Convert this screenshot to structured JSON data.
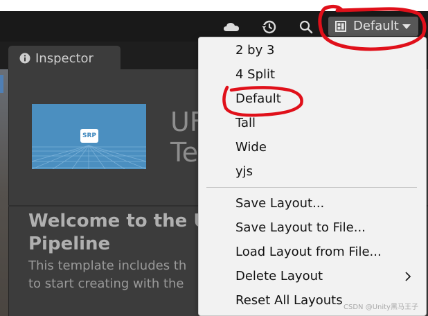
{
  "toolbar": {
    "cloud_icon": "cloud-icon",
    "history_icon": "history-icon",
    "search_icon": "search-icon",
    "layout_icon": "layout-icon",
    "layout_label": "Default"
  },
  "tab": {
    "icon": "info-icon",
    "label": "Inspector"
  },
  "inspector": {
    "preview_badge": "SRP",
    "title_line1": "UF",
    "title_line2": "Te",
    "heading_line1": "Welcome to the U",
    "heading_line2": "Pipeline",
    "body_line1": "This template includes th",
    "body_line2": "to start creating with the"
  },
  "menu": {
    "items": [
      {
        "label": "2 by 3"
      },
      {
        "label": "4 Split"
      },
      {
        "label": "Default"
      },
      {
        "label": "Tall"
      },
      {
        "label": "Wide"
      },
      {
        "label": "yjs"
      }
    ],
    "actions": [
      {
        "label": "Save Layout..."
      },
      {
        "label": "Save Layout to File..."
      },
      {
        "label": "Load Layout from File..."
      },
      {
        "label": "Delete Layout",
        "submenu": true
      },
      {
        "label": "Reset All Layouts"
      }
    ]
  },
  "colors": {
    "annotation": "#e0101a",
    "accent": "#4b8fc0"
  },
  "watermark": "CSDN @Unity黑马王子"
}
